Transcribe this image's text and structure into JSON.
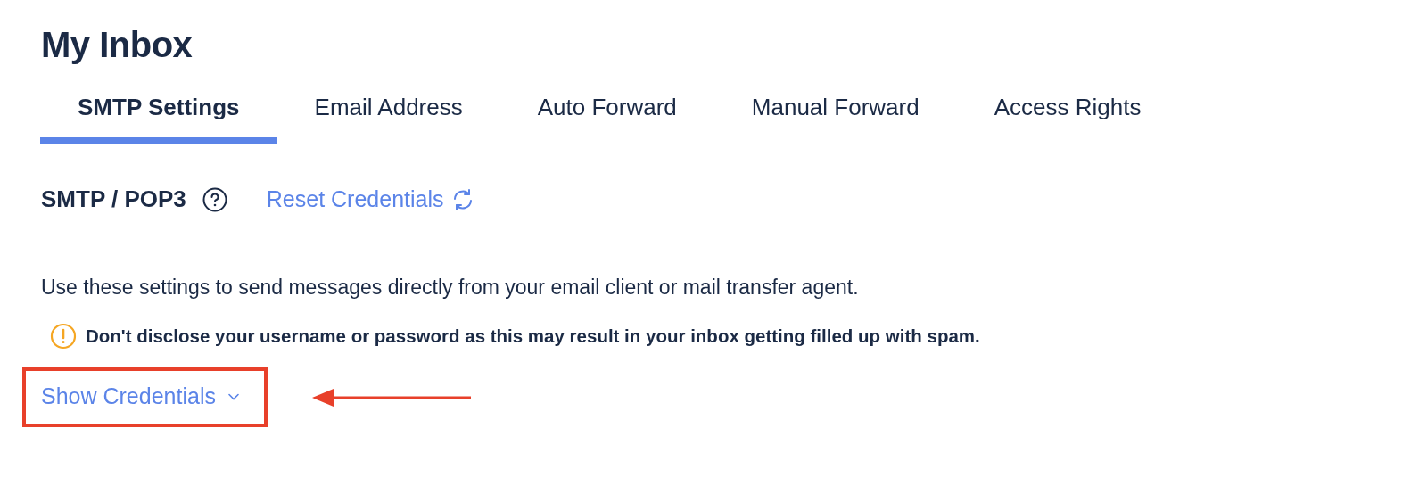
{
  "page_title": "My Inbox",
  "tabs": [
    {
      "label": "SMTP Settings",
      "selected": true
    },
    {
      "label": "Email Address",
      "selected": false
    },
    {
      "label": "Auto Forward",
      "selected": false
    },
    {
      "label": "Manual Forward",
      "selected": false
    },
    {
      "label": "Access Rights",
      "selected": false
    }
  ],
  "section": {
    "title": "SMTP / POP3",
    "reset_link": "Reset Credentials"
  },
  "description": "Use these settings to send messages directly from your email client or mail transfer agent.",
  "warning": "Don't disclose your username or password as this may result in your inbox getting filled up with spam.",
  "show_credentials": {
    "label": "Show Credentials",
    "expanded": false,
    "highlighted": true
  }
}
